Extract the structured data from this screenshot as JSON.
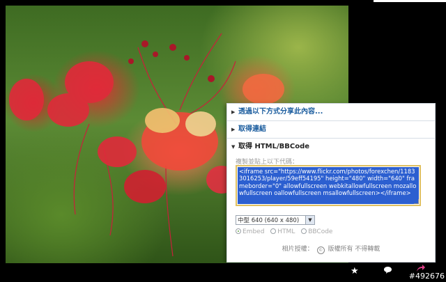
{
  "share_panel": {
    "share_via_label": "透過以下方式分享此內容...",
    "get_link_label": "取得連結",
    "get_html_label": "取得 HTML/BBCode",
    "copy_hint": "複製並貼上以下代碼：",
    "embed_code": "<iframe src=\"https://www.flickr.com/photos/forexchen/11833016253/player/59eff54195\" height=\"480\" width=\"640\" frameborder=\"0\" allowfullscreen webkitallowfullscreen mozallowfullscreen oallowfullscreen msallowfullscreen></iframe>",
    "size_selected": "中型 640 (640 x 480)",
    "format_options": [
      "Embed",
      "HTML",
      "BBCode"
    ],
    "format_selected": "Embed",
    "license_label": "相片授權：",
    "license_value": "版權所有 不得轉載"
  },
  "toolbar": {
    "favorite_icon": "star-icon",
    "comment_icon": "comment-icon",
    "share_icon": "share-icon"
  },
  "watermark": "#492676"
}
